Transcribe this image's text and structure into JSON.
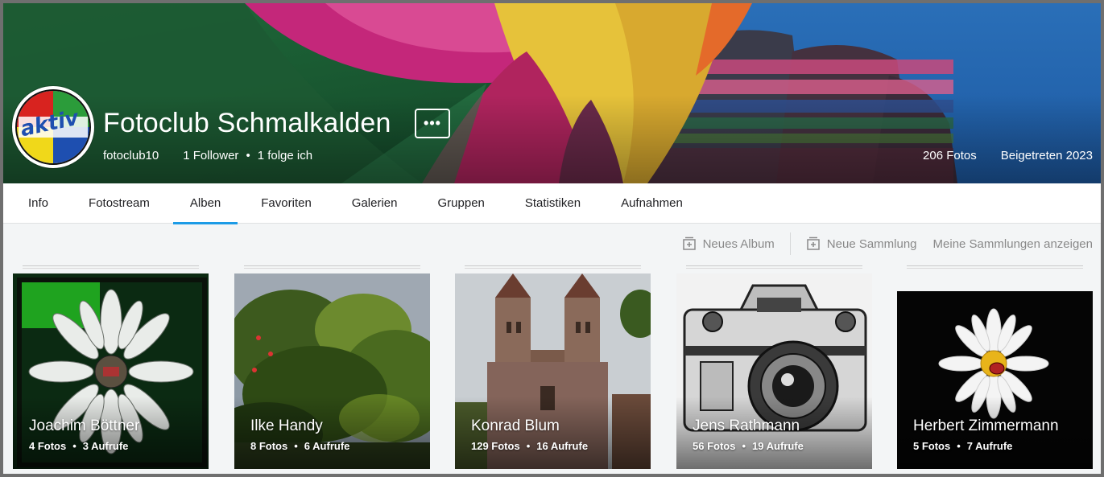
{
  "profile": {
    "title": "Fotoclub Schmalkalden",
    "username": "fotoclub10",
    "followers": "1 Follower",
    "following": "1 folge ich",
    "more_label": "•••",
    "photos_count": "206 Fotos",
    "joined": "Beigetreten 2023",
    "avatar_text": "aktiv"
  },
  "tabs": [
    {
      "label": "Info"
    },
    {
      "label": "Fotostream"
    },
    {
      "label": "Alben",
      "active": true
    },
    {
      "label": "Favoriten"
    },
    {
      "label": "Galerien"
    },
    {
      "label": "Gruppen"
    },
    {
      "label": "Statistiken"
    },
    {
      "label": "Aufnahmen"
    }
  ],
  "actions": {
    "new_album": "Neues Album",
    "new_collection": "Neue Sammlung",
    "show_collections": "Meine Sammlungen anzeigen"
  },
  "albums": [
    {
      "name": "Joachim Böttner",
      "photos": "4 Fotos",
      "views": "3 Aufrufe"
    },
    {
      "name": "Ilke Handy",
      "photos": "8 Fotos",
      "views": "6 Aufrufe"
    },
    {
      "name": "Konrad Blum",
      "photos": "129 Fotos",
      "views": "16 Aufrufe"
    },
    {
      "name": "Jens Rathmann",
      "photos": "56 Fotos",
      "views": "19 Aufrufe"
    },
    {
      "name": "Herbert Zimmermann",
      "photos": "5 Fotos",
      "views": "7 Aufrufe"
    }
  ],
  "colors": {
    "accent": "#1c9be6",
    "tab_text": "#212124",
    "muted": "#898989"
  },
  "icons": {
    "more": "ellipsis-icon",
    "new_album": "add-album-icon",
    "new_collection": "add-collection-icon"
  }
}
